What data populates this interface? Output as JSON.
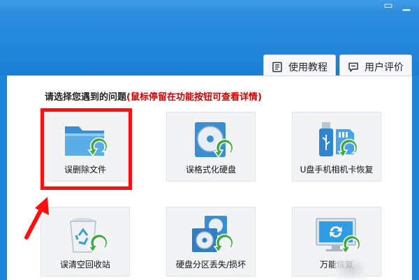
{
  "window": {
    "minimize_glyph": "▭",
    "close_glyph": "▁"
  },
  "header": {
    "tutorial_label": "使用教程",
    "tutorial_icon": "book-icon",
    "review_label": "用户评价",
    "review_icon": "comment-icon"
  },
  "prompt": {
    "main": "请选择您遇到的问题",
    "hint": "(鼠标停留在功能按钮可查看详情)"
  },
  "options": [
    {
      "label": "误删除文件",
      "icon": "folder-restore-icon"
    },
    {
      "label": "误格式化硬盘",
      "icon": "disk-restore-icon"
    },
    {
      "label": "U盘手机相机卡恢复",
      "icon": "usb-card-restore-icon"
    },
    {
      "label": "误清空回收站",
      "icon": "recycle-bin-restore-icon"
    },
    {
      "label": "硬盘分区丢失/损坏",
      "icon": "partition-restore-icon"
    },
    {
      "label": "万能恢复",
      "icon": "universal-restore-icon"
    }
  ],
  "colors": {
    "title_blue": "#1e86d6",
    "highlight_red": "#ff1010",
    "hint_red": "#d40000",
    "restore_arrow_green": "#3bab3b"
  }
}
